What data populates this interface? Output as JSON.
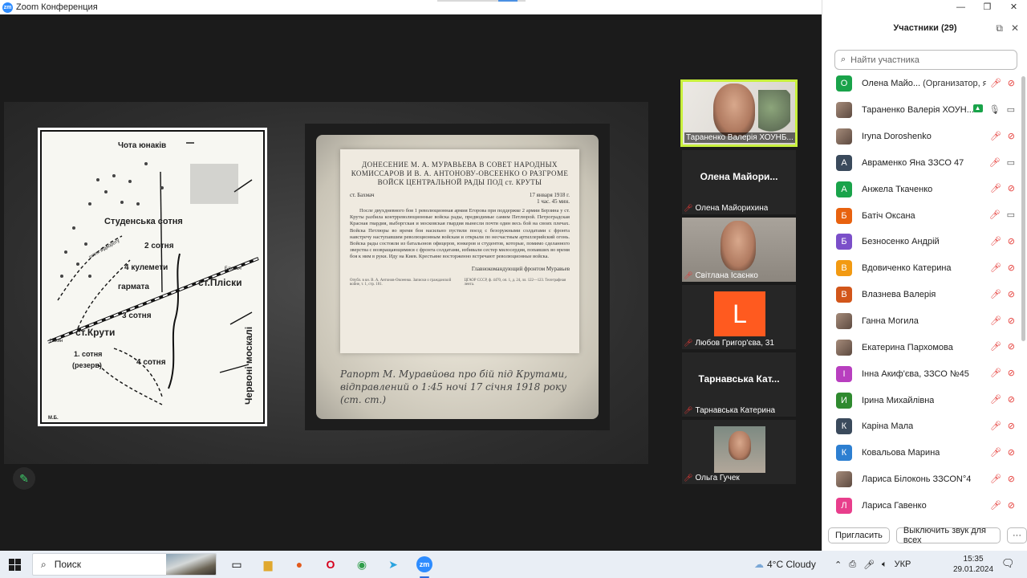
{
  "window": {
    "title": "Zoom Конференция",
    "controls": [
      "—",
      "❐",
      "✕"
    ]
  },
  "share": {
    "doc_title": "ДОНЕСЕНИЕ М. А. МУРАВЬЕВА В СОВЕТ НАРОДНЫХ КОМИССАРОВ И В. А. АНТОНОВУ-ОВСЕЕНКО О РАЗГРОМЕ ВОЙСК ЦЕНТРАЛЬНОЙ РАДЫ ПОД ст. КРУТЫ",
    "doc_place": "ст. Бахмач",
    "doc_date": "17 января 1918 г.",
    "doc_time": "1 час. 45 мин.",
    "doc_body": "После двухдневного боя 1 революционная армия Егорова при поддержке 2 армии Берзина у ст. Круты разбила контрреволюционные войска рады, предводимые самим Петлюрой. Петроградская Красная гвардия, выборгская и московская гвардия вынесли почти один весь бой на своих плечах. Войска Петлюры во время боя насильно пустили поезд с безоружными солдатами с фронта навстречу наступавшим революционным войскам и открыли по несчастным артиллерийский огонь. Войска рады состояли из батальонов офицеров, юнкеров и студентов, которые, помимо сделанного зверства с возвращающимися с фронта солдатами, избивали сестер милосердия, попавших во время боя к ним в руки. Иду на Киев. Крестьяне восторженно встречают революционные войска.",
    "doc_signature": "Главнокомандующий фронтом Муравьев",
    "doc_foot_left": "Опубл. в кн. В. А. Антонов-Овсеенко. Записки о гражданской войне, т. 1, стр. 181.",
    "doc_foot_right": "ЦГАОР СССР, ф. 4470, оп. 1, д. 24, лл. 122—123. Телеграфная лента.",
    "caption": "Рапорт М. Муравйова про бій під Крутами, відправлений о 1:45 ночі 17 січня 1918 року (ст. ст.)",
    "map_labels": {
      "top": "Чота юнаків",
      "studentska": "Студенська сотня",
      "sotnia2": "2 сотня",
      "shlyakh": "шлях відвороту",
      "kulemety": "4 кулемети",
      "garmata": "гармата",
      "st_pliski": "ст.Пліски",
      "sotnia3": "3 сотня",
      "st_kruty": "ст.Крути",
      "sotnia1": "1. сотня",
      "reserve": "(резерв)",
      "sotnia4": "4 сотня",
      "chervoni": "Червоні москалі",
      "nizhyn": "Ніжин",
      "bakhmach": "Бахмач",
      "initials": "М.Б."
    }
  },
  "thumbnails": [
    {
      "name": "Тараненко Валерія ХОУНБ...",
      "type": "video",
      "active": true,
      "muted": false
    },
    {
      "name": "Олена Майорихина",
      "center": "Олена Майори...",
      "type": "name",
      "muted": true
    },
    {
      "name": "Світлана Ісаєнко",
      "type": "video",
      "muted": true
    },
    {
      "name": "Любов Григор'єва, 31",
      "avatar": "L",
      "type": "avatar",
      "muted": true
    },
    {
      "name": "Тарнавська Катерина",
      "center": "Тарнавська Кат...",
      "type": "name",
      "muted": true
    },
    {
      "name": "Ольга Гучек",
      "type": "photo",
      "muted": true
    }
  ],
  "panel": {
    "title": "Участники (29)",
    "search_placeholder": "Найти участника",
    "invite": "Пригласить",
    "mute_all": "Выключить звук для всех",
    "more": "···"
  },
  "participants": [
    {
      "initial": "О",
      "color": "#19a34a",
      "name": "Олена Майо...",
      "role": "(Организатор, я)",
      "mic": "off",
      "cam": "off"
    },
    {
      "initial": "",
      "color": "photo",
      "name": "Тараненко Валерія ХОУН...",
      "mic": "on",
      "cam": "on",
      "sharing": true
    },
    {
      "initial": "",
      "color": "photo",
      "name": "Iryna Doroshenko",
      "mic": "off",
      "cam": "off"
    },
    {
      "initial": "А",
      "color": "#3a4a5c",
      "name": "Авраменко Яна ЗЗСО 47",
      "mic": "off",
      "cam": "on"
    },
    {
      "initial": "А",
      "color": "#19a34a",
      "name": "Анжела Ткаченко",
      "mic": "off",
      "cam": "off"
    },
    {
      "initial": "Б",
      "color": "#e8620f",
      "name": "Батіч Оксана",
      "mic": "off",
      "cam": "on"
    },
    {
      "initial": "Б",
      "color": "#7b4fc9",
      "name": "Безносенко Андрій",
      "mic": "off",
      "cam": "off"
    },
    {
      "initial": "В",
      "color": "#f29a12",
      "name": "Вдовиченко Катерина",
      "mic": "off",
      "cam": "off"
    },
    {
      "initial": "В",
      "color": "#d2561a",
      "name": "Влазнева Валерія",
      "mic": "off",
      "cam": "off"
    },
    {
      "initial": "",
      "color": "photo",
      "name": "Ганна Могила",
      "mic": "off",
      "cam": "off"
    },
    {
      "initial": "",
      "color": "photo",
      "name": "Екатерина Пархомова",
      "mic": "off",
      "cam": "off"
    },
    {
      "initial": "І",
      "color": "#b83fbf",
      "name": "Інна Акиф'єва, ЗЗСО №45",
      "mic": "off",
      "cam": "off"
    },
    {
      "initial": "И",
      "color": "#2f8a2f",
      "name": "Ірина Михайлівна",
      "mic": "off",
      "cam": "off"
    },
    {
      "initial": "К",
      "color": "#3a4a5c",
      "name": "Каріна Мала",
      "mic": "off",
      "cam": "off"
    },
    {
      "initial": "К",
      "color": "#2d7fd1",
      "name": "Ковальова Марина",
      "mic": "off",
      "cam": "off"
    },
    {
      "initial": "",
      "color": "photo",
      "name": "Лариса Білоконь ЗЗСОN°4",
      "mic": "off",
      "cam": "off"
    },
    {
      "initial": "Л",
      "color": "#e83e8c",
      "name": "Лариса Гавенко",
      "mic": "off",
      "cam": "off"
    }
  ],
  "taskbar": {
    "search_label": "Поиск",
    "weather": "4°C  Cloudy",
    "lang": "УКР",
    "time": "15:35",
    "date": "29.01.2024"
  }
}
